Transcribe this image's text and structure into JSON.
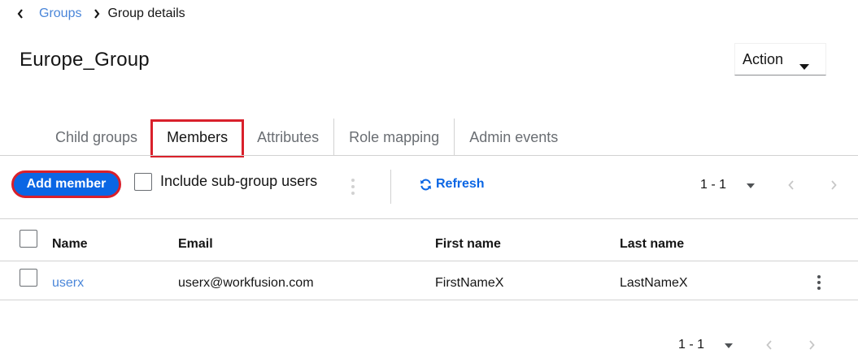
{
  "breadcrumb": {
    "parent": "Groups",
    "current": "Group details"
  },
  "page": {
    "title": "Europe_Group"
  },
  "action_dropdown": {
    "label": "Action"
  },
  "tabs": [
    {
      "label": "Child groups",
      "active": false
    },
    {
      "label": "Members",
      "active": true
    },
    {
      "label": "Attributes",
      "active": false
    },
    {
      "label": "Role mapping",
      "active": false
    },
    {
      "label": "Admin events",
      "active": false
    }
  ],
  "toolbar": {
    "add_member_label": "Add member",
    "include_subgroup_label": "Include sub-group users",
    "include_subgroup_checked": false,
    "refresh_label": "Refresh",
    "refresh_icon": "sync-icon",
    "kebab_icon": "kebab-icon"
  },
  "pagination": {
    "top_range": "1 - 1",
    "bottom_range": "1 - 1"
  },
  "table": {
    "columns": [
      "Name",
      "Email",
      "First name",
      "Last name"
    ],
    "rows": [
      {
        "name": "userx",
        "email": "userx@workfusion.com",
        "first_name": "FirstNameX",
        "last_name": "LastNameX",
        "checked": false
      }
    ]
  },
  "colors": {
    "primary": "#0b66e4",
    "link": "#4a86d9",
    "highlight": "#d9202b",
    "border": "#d2d2d2",
    "text": "#151515",
    "muted_text": "#6a6e73"
  }
}
